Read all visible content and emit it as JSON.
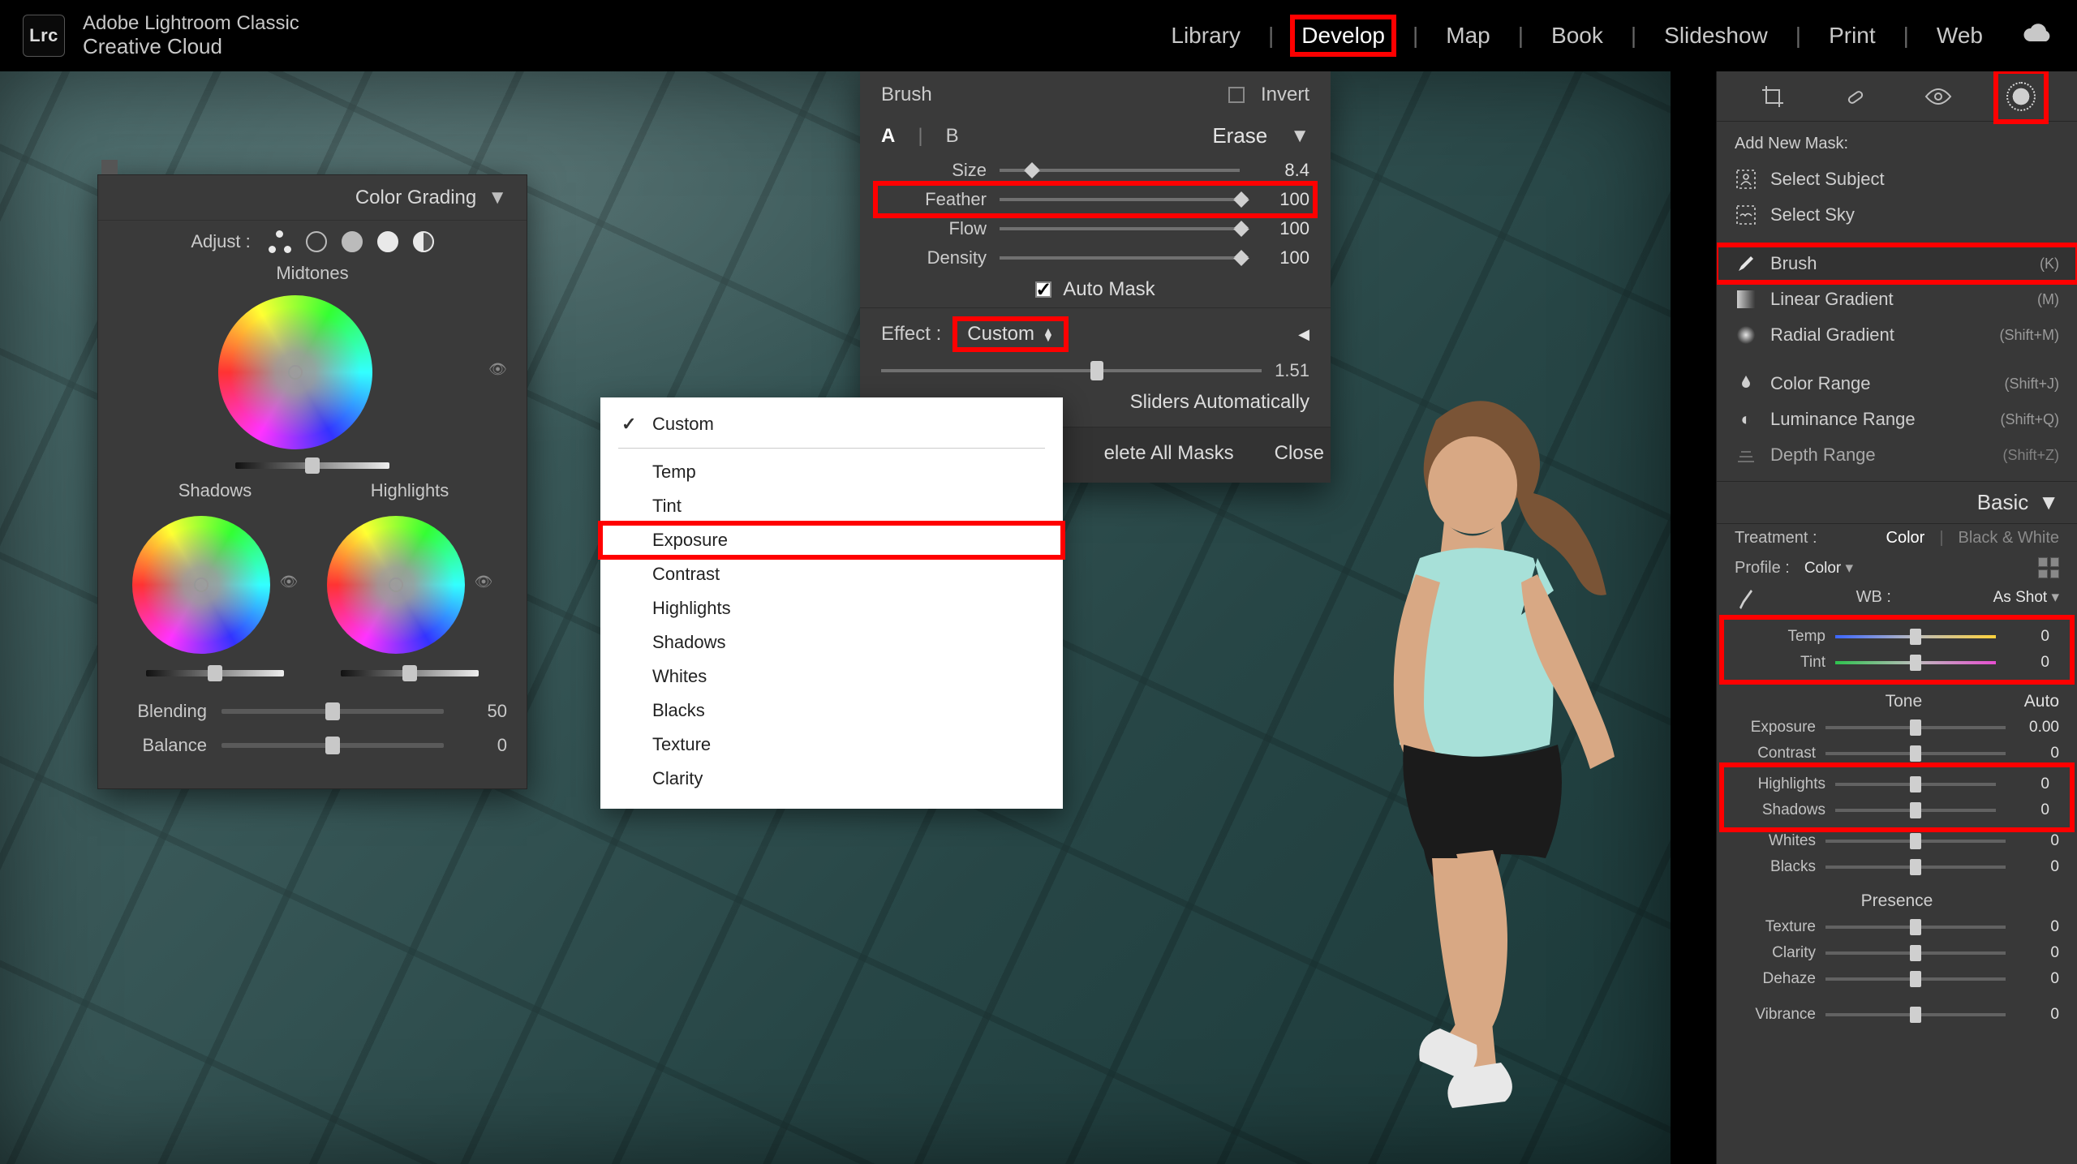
{
  "app": {
    "logo": "Lrc",
    "title1": "Adobe Lightroom Classic",
    "title2": "Creative Cloud"
  },
  "modules": {
    "items": [
      {
        "label": "Library"
      },
      {
        "label": "Develop",
        "active": true,
        "red": true
      },
      {
        "label": "Map"
      },
      {
        "label": "Book"
      },
      {
        "label": "Slideshow"
      },
      {
        "label": "Print"
      },
      {
        "label": "Web"
      }
    ]
  },
  "colorGrading": {
    "title": "Color Grading",
    "adjust": "Adjust :",
    "midtones": "Midtones",
    "shadows": "Shadows",
    "highlights": "Highlights",
    "blending": {
      "label": "Blending",
      "value": "50",
      "pos": 50
    },
    "balance": {
      "label": "Balance",
      "value": "0",
      "pos": 50
    }
  },
  "brush": {
    "title": "Brush",
    "invert": "Invert",
    "A": "A",
    "B": "B",
    "erase": "Erase",
    "size": {
      "label": "Size",
      "value": "8.4",
      "pos": 10
    },
    "feather": {
      "label": "Feather",
      "value": "100",
      "pos": 100,
      "red": true
    },
    "flow": {
      "label": "Flow",
      "value": "100",
      "pos": 100
    },
    "density": {
      "label": "Density",
      "value": "100",
      "pos": 100
    },
    "autoMask": "Auto Mask",
    "effectLabel": "Effect :",
    "effectValue": "Custom",
    "amount": {
      "value": "1.51",
      "pos": 55
    },
    "resetAuto": "Sliders Automatically",
    "deleteAll": "elete All Masks",
    "close": "Close"
  },
  "effectMenu": {
    "items": [
      {
        "label": "Custom",
        "checked": true
      },
      {
        "label": "Temp",
        "sep": true
      },
      {
        "label": "Tint"
      },
      {
        "label": "Exposure",
        "red": true
      },
      {
        "label": "Contrast"
      },
      {
        "label": "Highlights"
      },
      {
        "label": "Shadows"
      },
      {
        "label": "Whites"
      },
      {
        "label": "Blacks"
      },
      {
        "label": "Texture"
      },
      {
        "label": "Clarity"
      }
    ]
  },
  "sidebar": {
    "addNew": "Add New Mask:",
    "items": [
      {
        "label": "Select Subject",
        "icon": "subject"
      },
      {
        "label": "Select Sky",
        "icon": "sky"
      }
    ],
    "items2": [
      {
        "label": "Brush",
        "kb": "(K)",
        "icon": "brush",
        "red": true,
        "selected": true
      },
      {
        "label": "Linear Gradient",
        "kb": "(M)",
        "icon": "linear"
      },
      {
        "label": "Radial Gradient",
        "kb": "(Shift+M)",
        "icon": "radial"
      }
    ],
    "items3": [
      {
        "label": "Color Range",
        "kb": "(Shift+J)",
        "icon": "color"
      },
      {
        "label": "Luminance Range",
        "kb": "(Shift+Q)",
        "icon": "lum"
      },
      {
        "label": "Depth Range",
        "kb": "(Shift+Z)",
        "icon": "depth",
        "dim": true
      }
    ],
    "basic": {
      "title": "Basic",
      "treatment": "Treatment :",
      "color": "Color",
      "bw": "Black & White",
      "profile": "Profile :",
      "profileVal": "Color",
      "wb": "WB :",
      "wbVal": "As Shot",
      "temp": {
        "label": "Temp",
        "value": "0"
      },
      "tint": {
        "label": "Tint",
        "value": "0"
      },
      "toneTitle": "Tone",
      "auto": "Auto",
      "rows": [
        {
          "label": "Exposure",
          "value": "0.00"
        },
        {
          "label": "Contrast",
          "value": "0"
        },
        {
          "label": "Highlights",
          "value": "0",
          "red": true
        },
        {
          "label": "Shadows",
          "value": "0",
          "red": true
        },
        {
          "label": "Whites",
          "value": "0"
        },
        {
          "label": "Blacks",
          "value": "0"
        }
      ],
      "presenceTitle": "Presence",
      "rows2": [
        {
          "label": "Texture",
          "value": "0"
        },
        {
          "label": "Clarity",
          "value": "0"
        },
        {
          "label": "Dehaze",
          "value": "0"
        },
        {
          "label": "Vibrance",
          "value": "0"
        }
      ]
    }
  }
}
